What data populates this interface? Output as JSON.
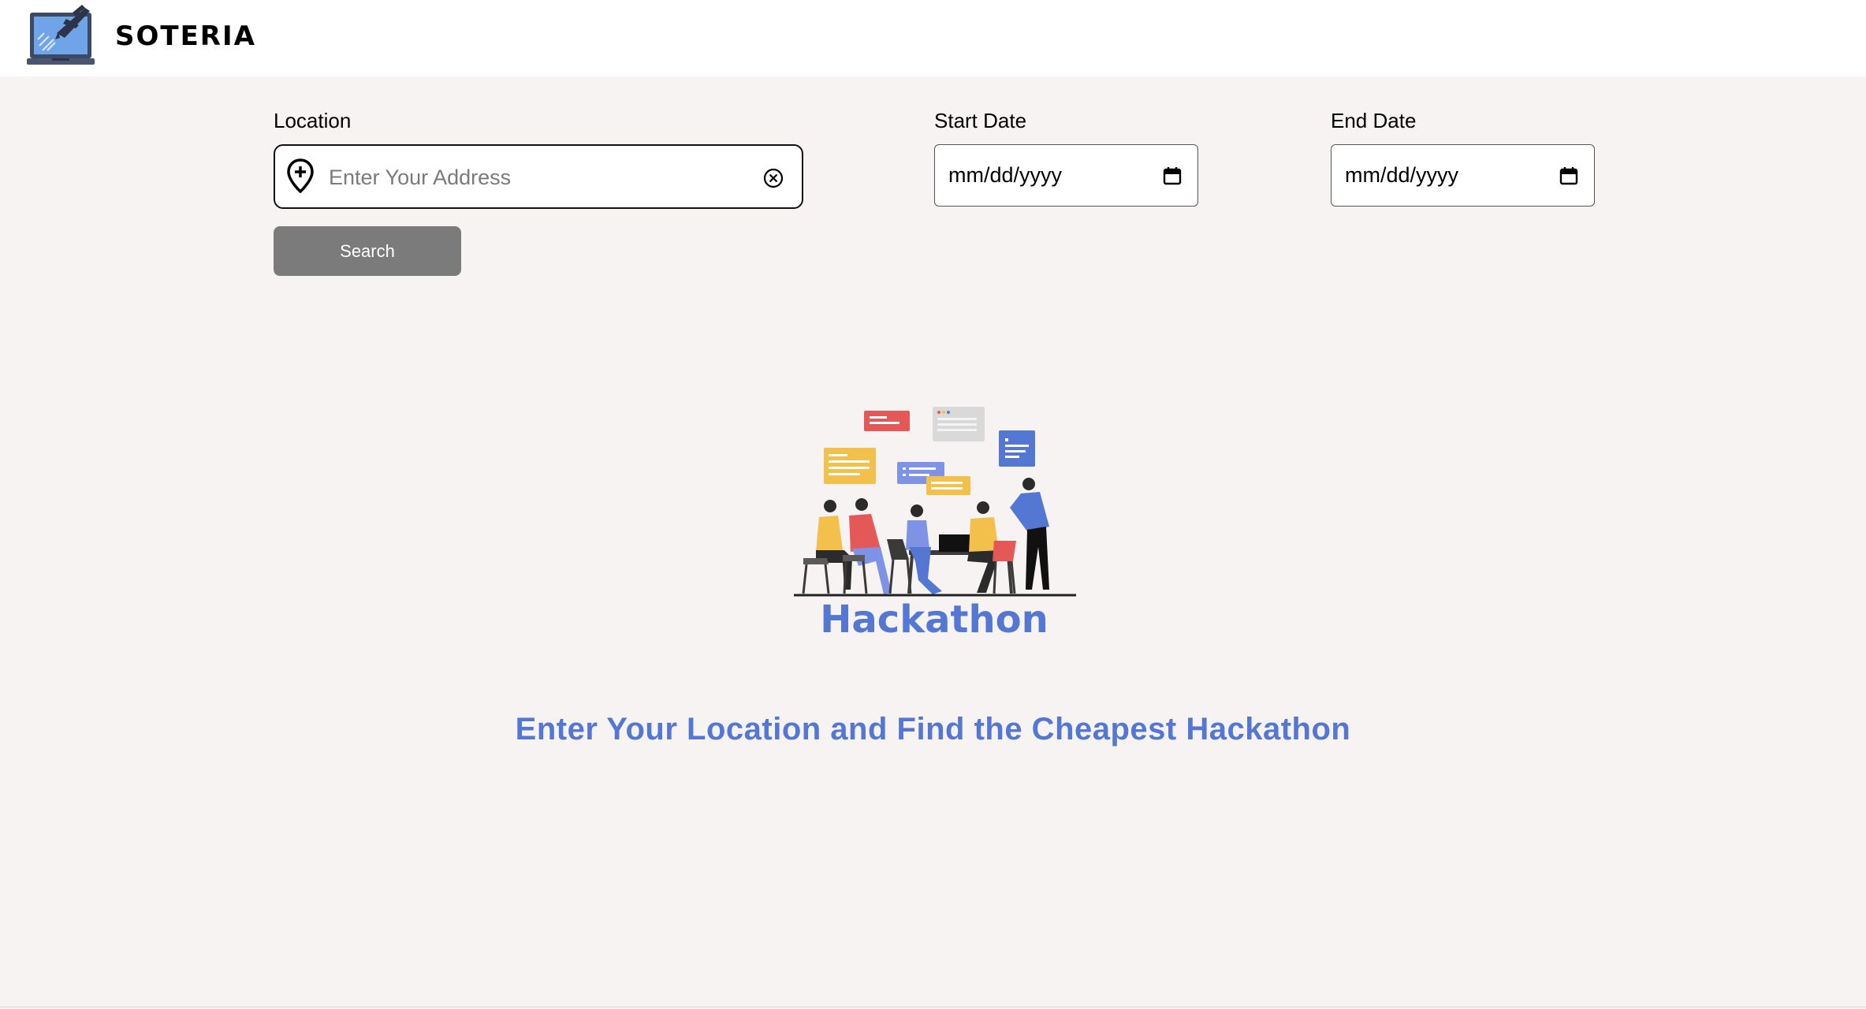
{
  "header": {
    "brand": "SOTERIA",
    "logo_icon": "laptop-airplane-icon"
  },
  "search_form": {
    "location": {
      "label": "Location",
      "placeholder": "Enter Your Address",
      "value": "",
      "leading_icon": "map-pin-plus-icon",
      "trailing_icon": "clear-circle-x-icon"
    },
    "start_date": {
      "label": "Start Date",
      "value": "mm/dd/yyyy",
      "icon": "calendar-icon"
    },
    "end_date": {
      "label": "End Date",
      "value": "mm/dd/yyyy",
      "icon": "calendar-icon"
    },
    "search_button": "Search"
  },
  "hero": {
    "illustration_title": "Hackathon",
    "tagline": "Enter Your Location and Find the Cheapest Hackathon"
  },
  "colors": {
    "accent": "#5477d4",
    "page_background": "#f6f3f2",
    "header_background": "#ffffff",
    "button_background": "#7b7b7b",
    "button_text": "#ffffff"
  }
}
